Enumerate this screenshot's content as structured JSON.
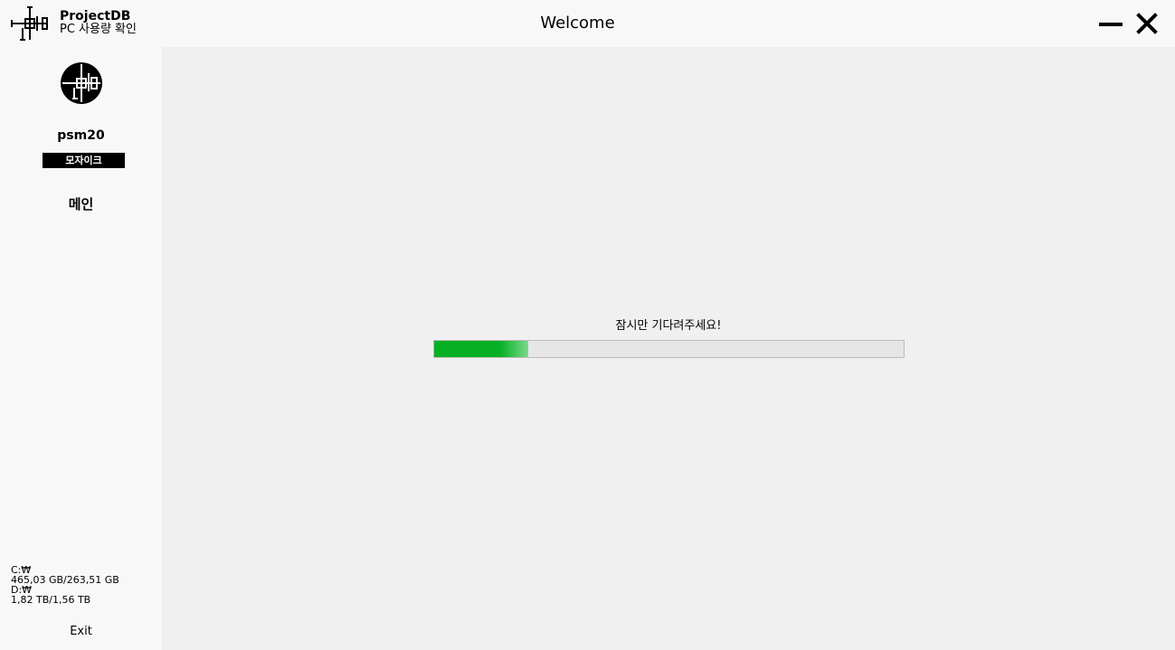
{
  "app": {
    "name": "ProjectDB",
    "subtitle": "PC 사용량 확인",
    "logo_icon": "circuit-logo-icon"
  },
  "window": {
    "title": "Welcome",
    "minimize_icon": "minimize-icon",
    "close_icon": "close-icon"
  },
  "sidebar": {
    "avatar_icon": "circuit-avatar-icon",
    "username": "psm20",
    "badge": "모자이크",
    "nav": {
      "main": "메인"
    },
    "disks": [
      {
        "label": "C:₩",
        "usage": "465,03 GB/263,51 GB"
      },
      {
        "label": "D:₩",
        "usage": "1,82 TB/1,56 TB"
      }
    ],
    "exit": "Exit"
  },
  "main": {
    "loading_text": "잠시만 기다려주세요!",
    "progress_fraction": 0.2
  },
  "colors": {
    "progress_fill": "#06b025",
    "badge_bg": "#000000",
    "content_bg": "#f0f0f0",
    "sidebar_bg": "#f8f8f8"
  }
}
